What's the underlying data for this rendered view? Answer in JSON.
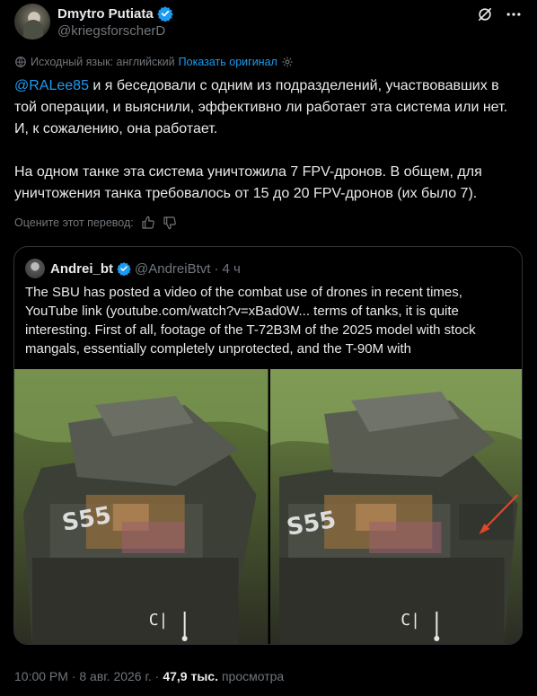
{
  "author": {
    "display_name": "Dmytro Putiata",
    "handle": "@kriegsforscherD"
  },
  "translation": {
    "source_label": "Исходный язык: английский",
    "show_original": "Показать оригинал",
    "rate_label": "Оцените этот перевод:"
  },
  "tweet": {
    "mention": "@RALee85",
    "paragraph1_rest": " и я беседовали с одним из подразделений, участвовавших в той операции, и выяснили, эффективно ли работает эта система или нет. И, к сожалению, она работает.",
    "paragraph2": "На одном танке эта система уничтожила 7 FPV-дронов. В общем, для уничтожения танка требовалось от 15 до 20 FPV-дронов (их было 7)."
  },
  "quote": {
    "display_name": "Andrei_bt",
    "handle": "@AndreiBtvt",
    "separator": "·",
    "time": "4 ч",
    "text": "The SBU has posted a video of the combat use of drones in recent times, YouTube link (youtube.com/watch?v=xBad0W... terms of tanks, it is quite interesting. First of all, footage of the T-72B3M of the 2025 model with stock mangals, essentially completely unprotected, and the T-90M with"
  },
  "footer": {
    "timestamp": "10:00 PM · 8 авг. 2026 г. ·",
    "views_count": "47,9 тыс.",
    "views_label": "просмотра"
  },
  "colors": {
    "background": "#000000",
    "text": "#e7e9ea",
    "muted": "#71767b",
    "accent": "#1d9bf0",
    "border": "#2f3336"
  },
  "icons": [
    "verified-badge-icon",
    "grok-icon",
    "more-icon",
    "translate-icon",
    "settings-icon",
    "thumbs-up-icon",
    "thumbs-down-icon"
  ]
}
